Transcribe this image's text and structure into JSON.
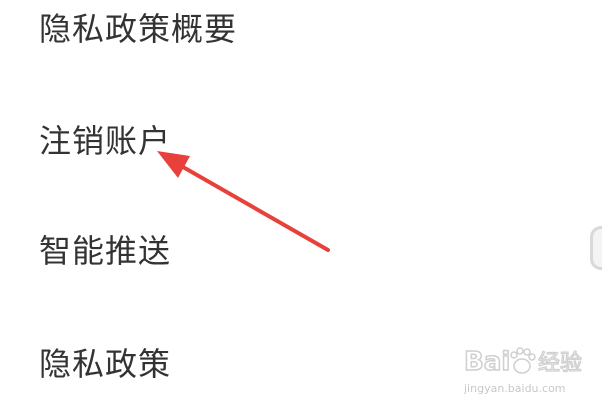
{
  "settings": {
    "items": [
      {
        "label": "隐私政策概要"
      },
      {
        "label": "注销账户"
      },
      {
        "label": "智能推送"
      },
      {
        "label": "隐私政策"
      }
    ]
  },
  "annotation": {
    "arrow_color": "#e8413b",
    "points_to": "注销账户"
  },
  "watermark": {
    "logo_text": "Bai 经验",
    "url_text": "jingyan.baidu.com"
  },
  "colors": {
    "background": "#ffffff",
    "text": "#333333",
    "accent_arrow": "#e8413b"
  }
}
